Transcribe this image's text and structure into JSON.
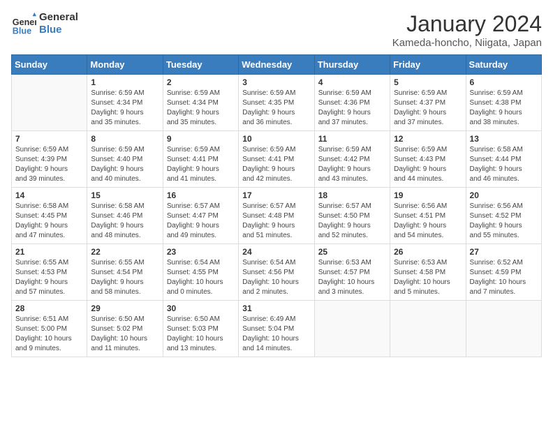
{
  "header": {
    "logo_line1": "General",
    "logo_line2": "Blue",
    "title": "January 2024",
    "subtitle": "Kameda-honcho, Niigata, Japan"
  },
  "days_of_week": [
    "Sunday",
    "Monday",
    "Tuesday",
    "Wednesday",
    "Thursday",
    "Friday",
    "Saturday"
  ],
  "weeks": [
    [
      {
        "num": "",
        "info": ""
      },
      {
        "num": "1",
        "info": "Sunrise: 6:59 AM\nSunset: 4:34 PM\nDaylight: 9 hours\nand 35 minutes."
      },
      {
        "num": "2",
        "info": "Sunrise: 6:59 AM\nSunset: 4:34 PM\nDaylight: 9 hours\nand 35 minutes."
      },
      {
        "num": "3",
        "info": "Sunrise: 6:59 AM\nSunset: 4:35 PM\nDaylight: 9 hours\nand 36 minutes."
      },
      {
        "num": "4",
        "info": "Sunrise: 6:59 AM\nSunset: 4:36 PM\nDaylight: 9 hours\nand 37 minutes."
      },
      {
        "num": "5",
        "info": "Sunrise: 6:59 AM\nSunset: 4:37 PM\nDaylight: 9 hours\nand 37 minutes."
      },
      {
        "num": "6",
        "info": "Sunrise: 6:59 AM\nSunset: 4:38 PM\nDaylight: 9 hours\nand 38 minutes."
      }
    ],
    [
      {
        "num": "7",
        "info": "Sunrise: 6:59 AM\nSunset: 4:39 PM\nDaylight: 9 hours\nand 39 minutes."
      },
      {
        "num": "8",
        "info": "Sunrise: 6:59 AM\nSunset: 4:40 PM\nDaylight: 9 hours\nand 40 minutes."
      },
      {
        "num": "9",
        "info": "Sunrise: 6:59 AM\nSunset: 4:41 PM\nDaylight: 9 hours\nand 41 minutes."
      },
      {
        "num": "10",
        "info": "Sunrise: 6:59 AM\nSunset: 4:41 PM\nDaylight: 9 hours\nand 42 minutes."
      },
      {
        "num": "11",
        "info": "Sunrise: 6:59 AM\nSunset: 4:42 PM\nDaylight: 9 hours\nand 43 minutes."
      },
      {
        "num": "12",
        "info": "Sunrise: 6:59 AM\nSunset: 4:43 PM\nDaylight: 9 hours\nand 44 minutes."
      },
      {
        "num": "13",
        "info": "Sunrise: 6:58 AM\nSunset: 4:44 PM\nDaylight: 9 hours\nand 46 minutes."
      }
    ],
    [
      {
        "num": "14",
        "info": "Sunrise: 6:58 AM\nSunset: 4:45 PM\nDaylight: 9 hours\nand 47 minutes."
      },
      {
        "num": "15",
        "info": "Sunrise: 6:58 AM\nSunset: 4:46 PM\nDaylight: 9 hours\nand 48 minutes."
      },
      {
        "num": "16",
        "info": "Sunrise: 6:57 AM\nSunset: 4:47 PM\nDaylight: 9 hours\nand 49 minutes."
      },
      {
        "num": "17",
        "info": "Sunrise: 6:57 AM\nSunset: 4:48 PM\nDaylight: 9 hours\nand 51 minutes."
      },
      {
        "num": "18",
        "info": "Sunrise: 6:57 AM\nSunset: 4:50 PM\nDaylight: 9 hours\nand 52 minutes."
      },
      {
        "num": "19",
        "info": "Sunrise: 6:56 AM\nSunset: 4:51 PM\nDaylight: 9 hours\nand 54 minutes."
      },
      {
        "num": "20",
        "info": "Sunrise: 6:56 AM\nSunset: 4:52 PM\nDaylight: 9 hours\nand 55 minutes."
      }
    ],
    [
      {
        "num": "21",
        "info": "Sunrise: 6:55 AM\nSunset: 4:53 PM\nDaylight: 9 hours\nand 57 minutes."
      },
      {
        "num": "22",
        "info": "Sunrise: 6:55 AM\nSunset: 4:54 PM\nDaylight: 9 hours\nand 58 minutes."
      },
      {
        "num": "23",
        "info": "Sunrise: 6:54 AM\nSunset: 4:55 PM\nDaylight: 10 hours\nand 0 minutes."
      },
      {
        "num": "24",
        "info": "Sunrise: 6:54 AM\nSunset: 4:56 PM\nDaylight: 10 hours\nand 2 minutes."
      },
      {
        "num": "25",
        "info": "Sunrise: 6:53 AM\nSunset: 4:57 PM\nDaylight: 10 hours\nand 3 minutes."
      },
      {
        "num": "26",
        "info": "Sunrise: 6:53 AM\nSunset: 4:58 PM\nDaylight: 10 hours\nand 5 minutes."
      },
      {
        "num": "27",
        "info": "Sunrise: 6:52 AM\nSunset: 4:59 PM\nDaylight: 10 hours\nand 7 minutes."
      }
    ],
    [
      {
        "num": "28",
        "info": "Sunrise: 6:51 AM\nSunset: 5:00 PM\nDaylight: 10 hours\nand 9 minutes."
      },
      {
        "num": "29",
        "info": "Sunrise: 6:50 AM\nSunset: 5:02 PM\nDaylight: 10 hours\nand 11 minutes."
      },
      {
        "num": "30",
        "info": "Sunrise: 6:50 AM\nSunset: 5:03 PM\nDaylight: 10 hours\nand 13 minutes."
      },
      {
        "num": "31",
        "info": "Sunrise: 6:49 AM\nSunset: 5:04 PM\nDaylight: 10 hours\nand 14 minutes."
      },
      {
        "num": "",
        "info": ""
      },
      {
        "num": "",
        "info": ""
      },
      {
        "num": "",
        "info": ""
      }
    ]
  ]
}
